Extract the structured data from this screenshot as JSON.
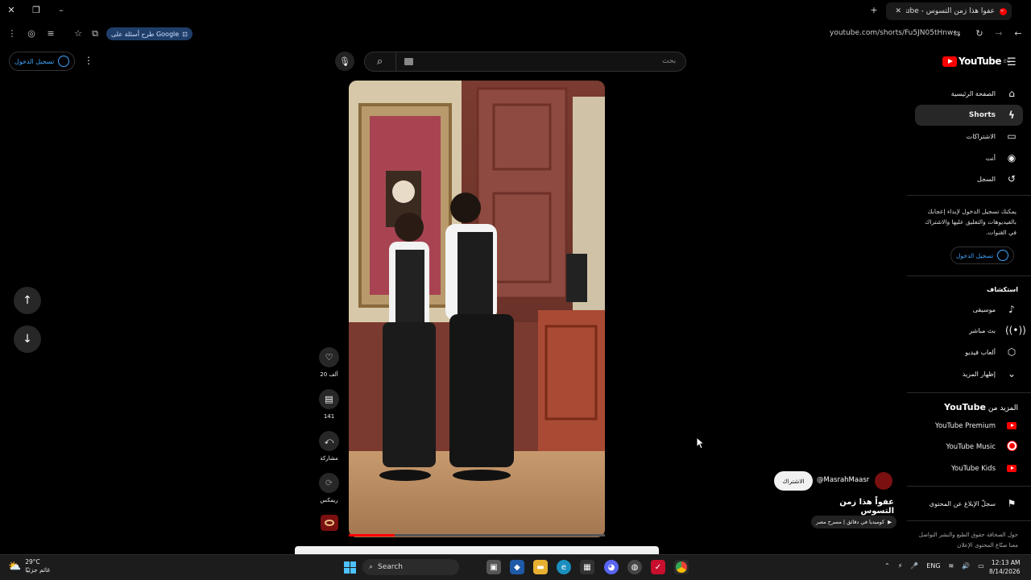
{
  "browser": {
    "tab_title": "عفواً هذا زمن التسوس - ube",
    "url": "youtube.com/shorts/Fu5JN05tHnw",
    "google_pill": "طرح أسئلة على Google"
  },
  "header": {
    "signin_label": "تسجيل الدخول",
    "search_placeholder": "بحث",
    "logo_text": "YouTube",
    "logo_region": "EG"
  },
  "sidebar": {
    "items": [
      {
        "label": "الصفحة الرئيسية",
        "icon": "home-icon"
      },
      {
        "label": "Shorts",
        "icon": "shorts-icon"
      },
      {
        "label": "الاشتراكات",
        "icon": "subscriptions-icon"
      },
      {
        "label": "أنت",
        "icon": "you-icon"
      },
      {
        "label": "السجل",
        "icon": "history-icon"
      }
    ],
    "signin_message": "يمكنك تسجيل الدخول لإبداء إعجابك بالفيديوهات والتعليق عليها والاشتراك في القنوات.",
    "signin_button": "تسجيل الدخول",
    "explore_title": "استكشاف",
    "explore": [
      {
        "label": "موسيقى",
        "icon": "music-icon"
      },
      {
        "label": "بث مباشر",
        "icon": "live-icon"
      },
      {
        "label": "ألعاب فيديو",
        "icon": "gaming-icon"
      },
      {
        "label": "إظهار المزيد",
        "icon": "chevron-down-icon"
      }
    ],
    "more_title_prefix": "المزيد من",
    "more_title_brand": "YouTube",
    "more": [
      {
        "label": "YouTube Premium",
        "color": "#ff0000"
      },
      {
        "label": "YouTube Music",
        "color": "#ff0000"
      },
      {
        "label": "YouTube Kids",
        "color": "#ff0000"
      }
    ],
    "report": "سجلّ الإبلاغ عن المحتوى",
    "footer": "حول   الصحافة   حقوق الطبع والنشر   التواصل معنا   صنّاع المحتوى   الإعلان"
  },
  "short": {
    "likes": "20 ألف",
    "comments": "141",
    "share": "مشاركة",
    "remix": "ريمكس",
    "progress": 0.18,
    "channel": "@MasrahMaasr",
    "subscribe": "الاشتراك",
    "title": "عفواً هذا زمن التسوس",
    "playlist": "كوميديا في دقائق | مسرح مصر"
  },
  "taskbar": {
    "temp": "29°C",
    "weather": "غائم جزئيًا",
    "search": "Search",
    "lang": "ENG",
    "time": "12:13 AM",
    "date": "8/14/2026"
  },
  "colors": {
    "accent": "#3ea6ff",
    "brand": "#ff0000"
  }
}
